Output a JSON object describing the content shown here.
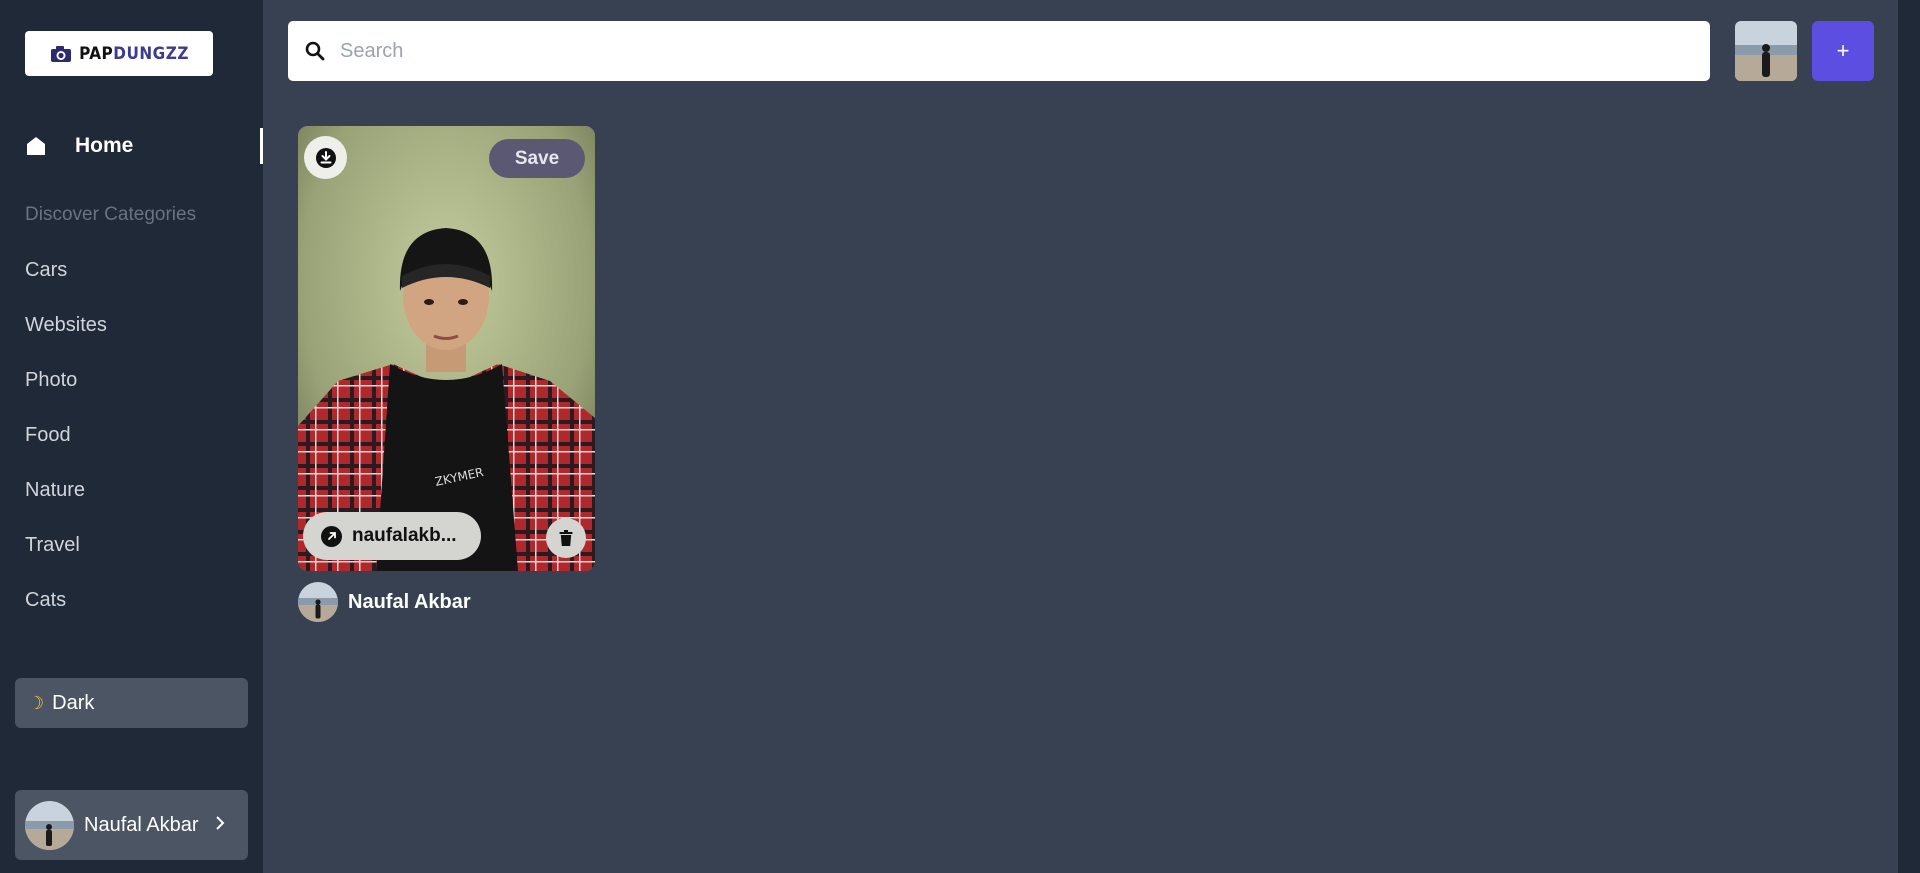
{
  "logo": {
    "part1": "PAP",
    "part2": "DUNGZZ",
    "icon": "camera-icon"
  },
  "sidebar": {
    "home_label": "Home",
    "section_title": "Discover Categories",
    "categories": [
      "Cars",
      "Websites",
      "Photo",
      "Food",
      "Nature",
      "Travel",
      "Cats"
    ],
    "theme_label": "Dark",
    "user_name": "Naufal Akbar"
  },
  "topbar": {
    "search_placeholder": "Search",
    "search_value": "",
    "add_label": "+"
  },
  "pin": {
    "save_label": "Save",
    "link_text": "naufalakb...",
    "author_name": "Naufal Akbar"
  },
  "colors": {
    "sidebar_bg": "#1f2937",
    "main_bg": "#374151",
    "accent": "#5b4ee0",
    "save_button": "#5b5874"
  }
}
